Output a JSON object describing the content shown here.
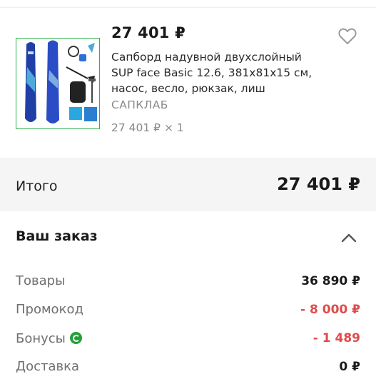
{
  "product": {
    "price": "27 401 ₽",
    "title": "Сапборд надувной двухслойный SUP face Basic 12.6, 381x81x15 см, насос, весло, рюкзак, лиш",
    "seller": "САПКЛАБ",
    "quantity_line": "27 401 ₽ × 1",
    "image_icon": "paddleboard-product-image",
    "favorite_icon": "heart-outline-icon"
  },
  "total": {
    "label": "Итого",
    "value": "27 401 ₽"
  },
  "order": {
    "title": "Ваш заказ",
    "toggle_icon": "chevron-up-icon",
    "rows": [
      {
        "label": "Товары",
        "value": "36 890 ₽"
      },
      {
        "label": "Промокод",
        "value": "- 8 000 ₽"
      },
      {
        "label": "Бонусы",
        "value": "- 1 489"
      },
      {
        "label": "Доставка",
        "value": "0 ₽"
      }
    ]
  },
  "colors": {
    "accent_green": "#21a038",
    "discount_red": "#e04a4a",
    "muted_text": "#8a8a8a",
    "section_bg": "#f5f5f5"
  }
}
